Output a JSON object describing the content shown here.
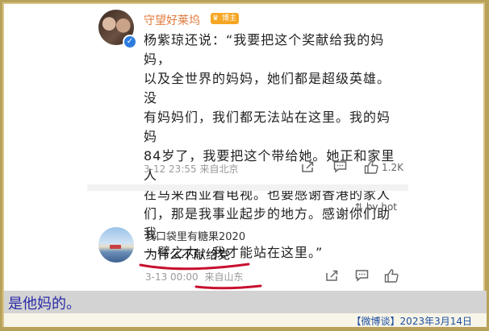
{
  "post": {
    "username": "守望好莱坞",
    "badge": "博主",
    "text": "杨紫琼还说：“我要把这个奖献给我的妈妈，\n以及全世界的妈妈，她们都是超级英雄。没\n有妈妈们，我们都无法站在这里。我的妈妈\n84岁了，我要把这个带给她。她正和家里人\n在马来西亚看电视。也要感谢香港的家人\n们，那是我事业起步的地方。感谢你们助我\n一臂之力，我才能站在这里。”",
    "meta": "3-12 23:55  来自北京",
    "like_count": "1.2K",
    "icons": [
      "share-icon",
      "comment-icon",
      "like-icon"
    ]
  },
  "sort": {
    "label": "by hot"
  },
  "comment": {
    "username": "我口袋里有糖果2020",
    "text": "为什么不献给党",
    "time": "3-13 00:00",
    "location": "来自山东"
  },
  "caption": {
    "text": "是他妈的。"
  },
  "footer": {
    "text": "【微博谈】2023年3月14日"
  },
  "colors": {
    "username": "#e0793a",
    "underline": "#c8102e",
    "caption": "#2a2aa8",
    "footer": "#1d4fa0"
  }
}
